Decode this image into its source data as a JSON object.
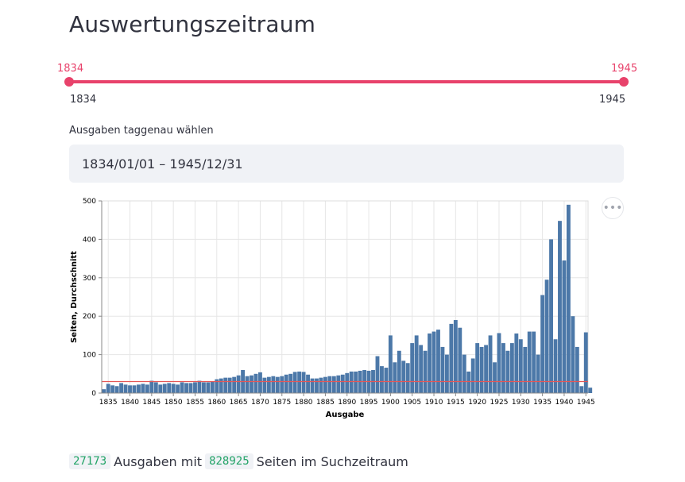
{
  "page": {
    "title": "Auswertungszeitraum"
  },
  "slider": {
    "min_label": "1834",
    "max_label": "1945",
    "selected_min": "1834",
    "selected_max": "1945",
    "accent_color": "#e8426b"
  },
  "date_picker": {
    "label": "Ausgaben taggenau wählen",
    "value": "1834/01/01 – 1945/12/31"
  },
  "menu": {
    "icon": "ellipsis-icon",
    "glyph": "•••"
  },
  "chart_data": {
    "type": "bar",
    "xlabel": "Ausgabe",
    "ylabel": "Seiten, Durchschnitt",
    "ylim": [
      0,
      500
    ],
    "yticks": [
      0,
      100,
      200,
      300,
      400,
      500
    ],
    "xlim": [
      1834,
      1945
    ],
    "xticks": [
      1835,
      1840,
      1845,
      1850,
      1855,
      1860,
      1865,
      1870,
      1875,
      1880,
      1885,
      1890,
      1895,
      1900,
      1905,
      1910,
      1915,
      1920,
      1925,
      1930,
      1935,
      1940,
      1945
    ],
    "grid": true,
    "bar_color": "#4c78a8",
    "reference_line": {
      "value": 30,
      "color": "#e45756"
    },
    "x": [
      1834,
      1835,
      1836,
      1837,
      1838,
      1839,
      1840,
      1841,
      1842,
      1843,
      1844,
      1845,
      1846,
      1847,
      1848,
      1849,
      1850,
      1851,
      1852,
      1853,
      1854,
      1855,
      1856,
      1857,
      1858,
      1859,
      1860,
      1861,
      1862,
      1863,
      1864,
      1865,
      1866,
      1867,
      1868,
      1869,
      1870,
      1871,
      1872,
      1873,
      1874,
      1875,
      1876,
      1877,
      1878,
      1879,
      1880,
      1881,
      1882,
      1883,
      1884,
      1885,
      1886,
      1887,
      1888,
      1889,
      1890,
      1891,
      1892,
      1893,
      1894,
      1895,
      1896,
      1897,
      1898,
      1899,
      1900,
      1901,
      1902,
      1903,
      1904,
      1905,
      1906,
      1907,
      1908,
      1909,
      1910,
      1911,
      1912,
      1913,
      1914,
      1915,
      1916,
      1917,
      1918,
      1919,
      1920,
      1921,
      1922,
      1923,
      1924,
      1925,
      1926,
      1927,
      1928,
      1929,
      1930,
      1931,
      1932,
      1933,
      1934,
      1935,
      1936,
      1937,
      1938,
      1939,
      1940,
      1941,
      1942,
      1943,
      1944,
      1945
    ],
    "values": [
      10,
      24,
      20,
      18,
      26,
      22,
      20,
      20,
      22,
      24,
      22,
      32,
      28,
      22,
      24,
      26,
      24,
      22,
      28,
      26,
      26,
      28,
      32,
      28,
      28,
      30,
      36,
      38,
      40,
      40,
      42,
      46,
      60,
      44,
      46,
      50,
      54,
      40,
      42,
      44,
      42,
      44,
      48,
      50,
      55,
      56,
      55,
      48,
      38,
      38,
      40,
      42,
      44,
      44,
      46,
      48,
      52,
      56,
      56,
      58,
      60,
      58,
      60,
      96,
      70,
      66,
      150,
      80,
      110,
      84,
      78,
      130,
      150,
      125,
      110,
      155,
      160,
      165,
      120,
      100,
      180,
      190,
      170,
      100,
      56,
      90,
      130,
      120,
      125,
      150,
      80,
      156,
      130,
      110,
      130,
      155,
      140,
      120,
      160,
      160,
      100,
      255,
      295,
      400,
      140,
      448,
      345,
      490,
      200,
      120,
      18,
      158,
      14
    ]
  },
  "summary": {
    "count_editions": "27173",
    "text_mid": "Ausgaben mit",
    "count_pages": "828925",
    "text_end": "Seiten im Suchzeitraum"
  }
}
